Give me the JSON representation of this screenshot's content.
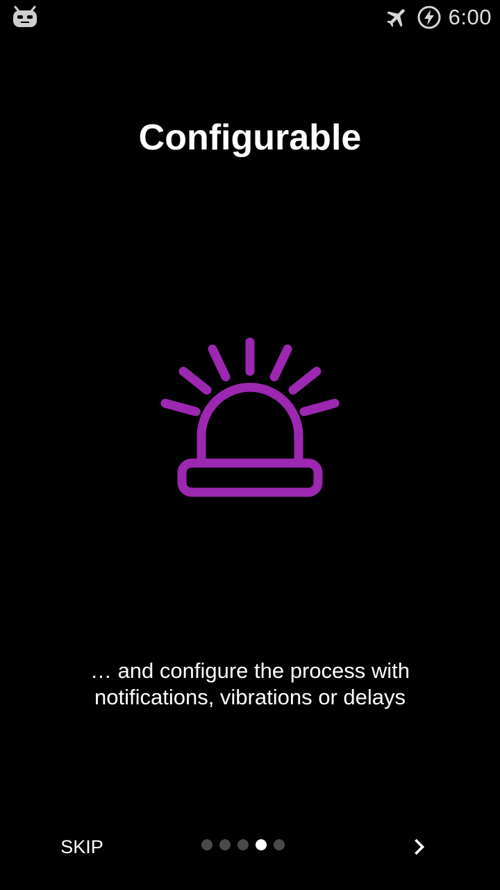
{
  "status_bar": {
    "left_icon": "cyanogenmod-bugdroid-icon",
    "airplane_icon": "airplane-mode-icon",
    "battery_icon": "battery-charging-icon",
    "time": "6:00"
  },
  "onboarding": {
    "title": "Configurable",
    "illustration_icon": "alarm-siren-icon",
    "description": "… and configure the process with notifications, vibrations or delays"
  },
  "navigation": {
    "skip_label": "SKIP",
    "next_icon": "chevron-right-icon",
    "pages_total": 5,
    "active_page_index": 3
  },
  "colors": {
    "background": "#000000",
    "accent": "#9c27b0",
    "text": "#ffffff",
    "dot_inactive": "#4a4a4a",
    "dot_active": "#ffffff"
  }
}
